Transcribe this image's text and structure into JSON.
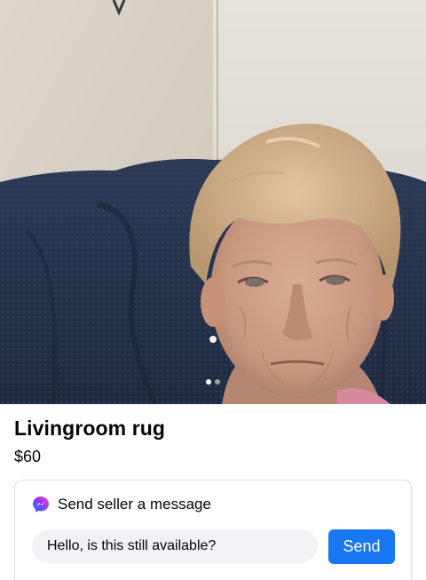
{
  "listing": {
    "title": "Livingroom rug",
    "price": "$60"
  },
  "carousel": {
    "photo_count": 2,
    "active_index": 0,
    "photo_icon": "photo-of-elderly-woman-on-blue-blanket"
  },
  "message_card": {
    "title": "Send seller a message",
    "icon": "messenger-icon",
    "input_value": "Hello, is this still available?",
    "send_label": "Send"
  },
  "colors": {
    "accent": "#1877f2",
    "input_bg": "#f0f2f5",
    "text": "#050505",
    "card_border": "#dadde1"
  }
}
